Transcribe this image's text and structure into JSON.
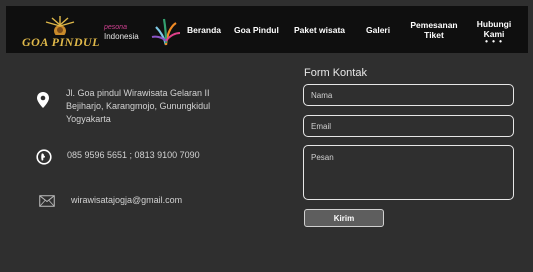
{
  "header": {
    "logo_text": "GOA PINDUL",
    "partner_logo": {
      "line1": "pesona",
      "line2": "Indonesia"
    },
    "nav": [
      {
        "label": "Beranda"
      },
      {
        "label": "Goa Pindul"
      },
      {
        "label": "Paket wisata"
      },
      {
        "label": "Galeri"
      },
      {
        "label": "Pemesanan Tiket"
      },
      {
        "label": "Hubungi Kami"
      }
    ]
  },
  "contact": {
    "address": "Jl. Goa pindul Wirawisata Gelaran II Bejiharjo, Karangmojo, Gunungkidul Yogyakarta",
    "phone": "085 9596 5651 ; 0813 9100 7090",
    "email": "wirawisatajogja@gmail.com"
  },
  "form": {
    "title": "Form Kontak",
    "name_placeholder": "Nama",
    "email_placeholder": "Email",
    "message_placeholder": "Pesan",
    "submit_label": "Kirim"
  },
  "colors": {
    "page_bg": "#2f2f2f",
    "header_bg": "#0f0f0f",
    "logo_gold": "#e0b94a",
    "text_light": "#d2d2d2"
  }
}
